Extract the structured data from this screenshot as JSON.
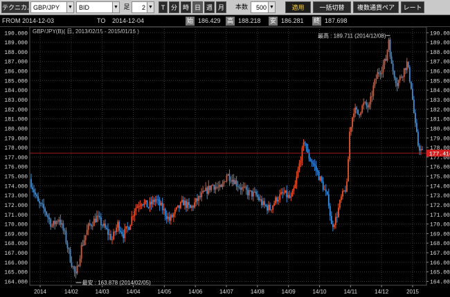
{
  "toolbar": {
    "tab_label": "テクニカル",
    "pair": "GBP/JPY",
    "side": "BID",
    "foot_label": "足",
    "timeframe": "2",
    "period_t": "T",
    "period_min": "分",
    "period_hour": "時",
    "period_day": "日",
    "period_week": "週",
    "period_month": "月",
    "bars_label": "本数",
    "bars_value": "500",
    "apply_label": "適用",
    "bulk_switch_label": "一括切替",
    "multi_pair_label": "複数通貨ペア",
    "rate_label": "レート"
  },
  "range": {
    "from_label": "FROM",
    "from_date": "2014-12-03",
    "to_label": "TO",
    "to_date": "2014-12-04",
    "open_label": "始",
    "open_value": "186.429",
    "high_label": "高",
    "high_value": "188.218",
    "low_label": "安",
    "low_value": "186.281",
    "close_label": "終",
    "close_value": "187.698"
  },
  "colors": {
    "up": "#e8532a",
    "down": "#3a8fe0",
    "grid": "#3a3a3a",
    "price_line": "#d42020",
    "text": "#dddddd"
  },
  "chart_data": {
    "type": "candlestick",
    "title": "GBP/JPY(B)( 日, 2013/02/15 - 2015/01/16 )",
    "ylim": [
      163.6,
      190.6
    ],
    "y_ticks": [
      164.0,
      165.0,
      166.0,
      167.0,
      168.0,
      169.0,
      170.0,
      171.0,
      172.0,
      173.0,
      174.0,
      175.0,
      176.0,
      177.0,
      178.0,
      179.0,
      180.0,
      181.0,
      182.0,
      183.0,
      184.0,
      185.0,
      186.0,
      187.0,
      188.0,
      189.0,
      190.0
    ],
    "x_tick_labels": [
      "2014",
      "14/02",
      "14/03",
      "14/04",
      "14/05",
      "14/06",
      "14/07",
      "14/08",
      "14/09",
      "14/10",
      "14/11",
      "14/12",
      "2015"
    ],
    "current_price_label": "177.414",
    "current_price": 177.414,
    "max_annotation": "最高 : 189.711 (2014/12/08)",
    "min_annotation": "最安 : 163.878 (2014/02/05)",
    "max_value": 189.711,
    "min_value": 163.878,
    "close_path": [
      [
        0,
        174.3
      ],
      [
        5,
        172.2
      ],
      [
        10,
        171.4
      ],
      [
        15,
        169.8
      ],
      [
        20,
        170.6
      ],
      [
        24,
        168.9
      ],
      [
        28,
        166.4
      ],
      [
        32,
        164.5
      ],
      [
        36,
        167.6
      ],
      [
        41,
        169.7
      ],
      [
        47,
        170.7
      ],
      [
        53,
        169.5
      ],
      [
        58,
        168.4
      ],
      [
        62,
        170.0
      ],
      [
        66,
        168.9
      ],
      [
        70,
        169.8
      ],
      [
        74,
        171.6
      ],
      [
        79,
        172.4
      ],
      [
        84,
        171.8
      ],
      [
        89,
        172.6
      ],
      [
        94,
        171.6
      ],
      [
        99,
        170.4
      ],
      [
        104,
        171.4
      ],
      [
        109,
        172.3
      ],
      [
        114,
        171.6
      ],
      [
        119,
        172.5
      ],
      [
        125,
        173.4
      ],
      [
        130,
        174.1
      ],
      [
        136,
        173.6
      ],
      [
        140,
        175.2
      ],
      [
        145,
        174.6
      ],
      [
        150,
        173.8
      ],
      [
        155,
        173.3
      ],
      [
        161,
        173.0
      ],
      [
        166,
        172.0
      ],
      [
        171,
        171.6
      ],
      [
        176,
        172.7
      ],
      [
        181,
        173.2
      ],
      [
        186,
        172.6
      ],
      [
        189,
        174.0
      ],
      [
        193,
        177.0
      ],
      [
        196,
        178.7
      ],
      [
        198,
        177.2
      ],
      [
        203,
        176.0
      ],
      [
        208,
        174.3
      ],
      [
        213,
        172.3
      ],
      [
        215,
        169.8
      ],
      [
        218,
        170.5
      ],
      [
        222,
        172.7
      ],
      [
        226,
        174.0
      ],
      [
        228,
        179.6
      ],
      [
        231,
        182.0
      ],
      [
        234,
        181.5
      ],
      [
        238,
        182.5
      ],
      [
        242,
        182.2
      ],
      [
        245,
        184.3
      ],
      [
        248,
        185.7
      ],
      [
        251,
        186.3
      ],
      [
        254,
        187.2
      ],
      [
        256,
        189.4
      ],
      [
        258,
        186.5
      ],
      [
        262,
        184.7
      ],
      [
        265,
        185.5
      ],
      [
        269,
        186.8
      ],
      [
        272,
        184.4
      ],
      [
        275,
        180.2
      ],
      [
        277,
        178.3
      ],
      [
        280,
        177.4
      ]
    ]
  }
}
